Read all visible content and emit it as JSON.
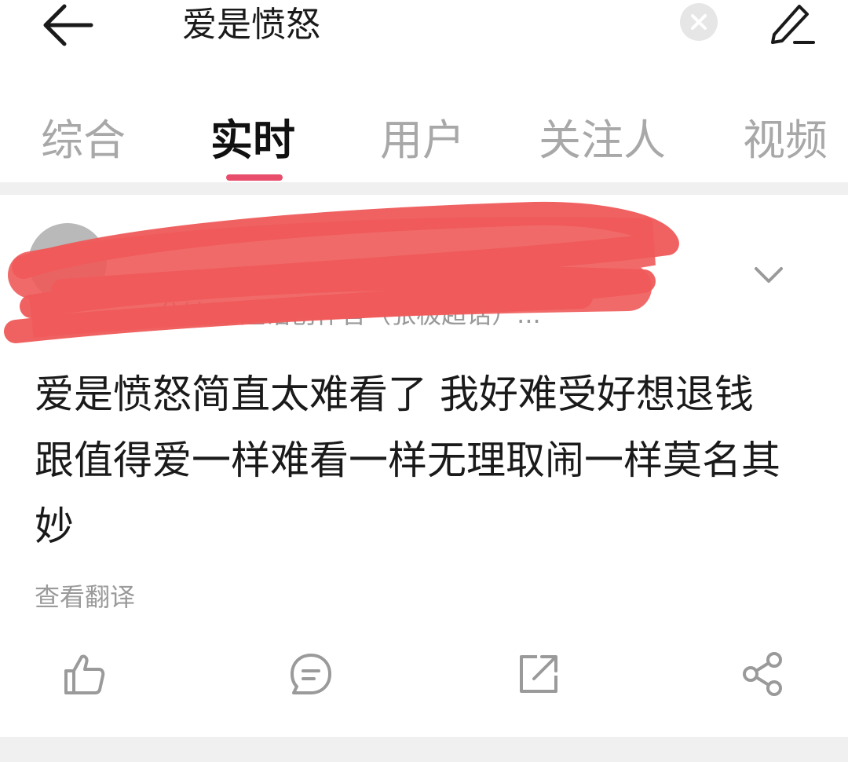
{
  "header": {
    "search_query": "爱是愤怒",
    "back_icon": "arrow-left-icon",
    "clear_icon": "close-circle-icon",
    "edit_icon": "pencil-icon"
  },
  "tabs": [
    {
      "label": "综合",
      "active": false
    },
    {
      "label": "实时",
      "active": true
    },
    {
      "label": "用户",
      "active": false
    },
    {
      "label": "关注人",
      "active": false
    },
    {
      "label": "视频",
      "active": false
    }
  ],
  "accent_color": "#e84d6c",
  "post": {
    "meta": "分钟前 超话创作官（张极超话）...",
    "text": "爱是愤怒简直太难看了 我好难受好想退钱 跟值得爱一样难看一样无理取闹一样莫名其妙",
    "translate_label": "查看翻译",
    "redaction_color": "#f05a5a"
  },
  "actions": [
    {
      "icon": "thumbs-up-icon"
    },
    {
      "icon": "comment-icon"
    },
    {
      "icon": "repost-icon"
    },
    {
      "icon": "share-icon"
    }
  ]
}
